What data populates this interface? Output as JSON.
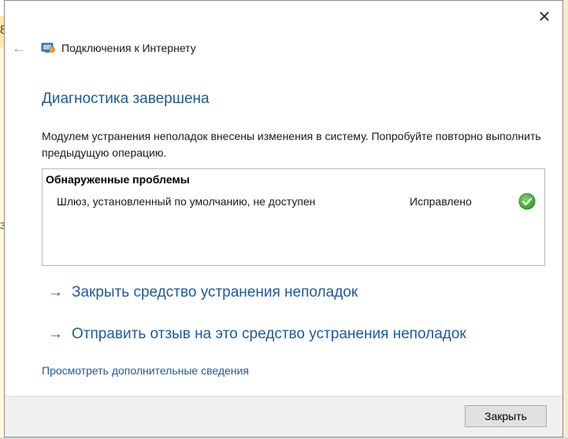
{
  "background": {
    "glyph_top": "8",
    "glyph_mid": "3"
  },
  "window": {
    "title": "Подключения к Интернету",
    "close_symbol": "✕",
    "back_symbol": "←"
  },
  "main": {
    "heading": "Диагностика завершена",
    "description": "Модулем устранения неполадок внесены изменения в систему. Попробуйте повторно выполнить предыдущую операцию.",
    "problems": {
      "header": "Обнаруженные проблемы",
      "items": [
        {
          "text": "Шлюз, установленный по умолчанию, не доступен",
          "status": "Исправлено",
          "status_icon": "check-circle-green-icon"
        }
      ]
    },
    "actions": {
      "arrow": "→",
      "close_troubleshooter": "Закрыть средство устранения неполадок",
      "send_feedback": "Отправить отзыв на это средство устранения неполадок"
    },
    "more_info": "Просмотреть дополнительные сведения"
  },
  "footer": {
    "close_button": "Закрыть"
  },
  "colors": {
    "accent": "#1e5aa0",
    "success": "#3aa639"
  }
}
